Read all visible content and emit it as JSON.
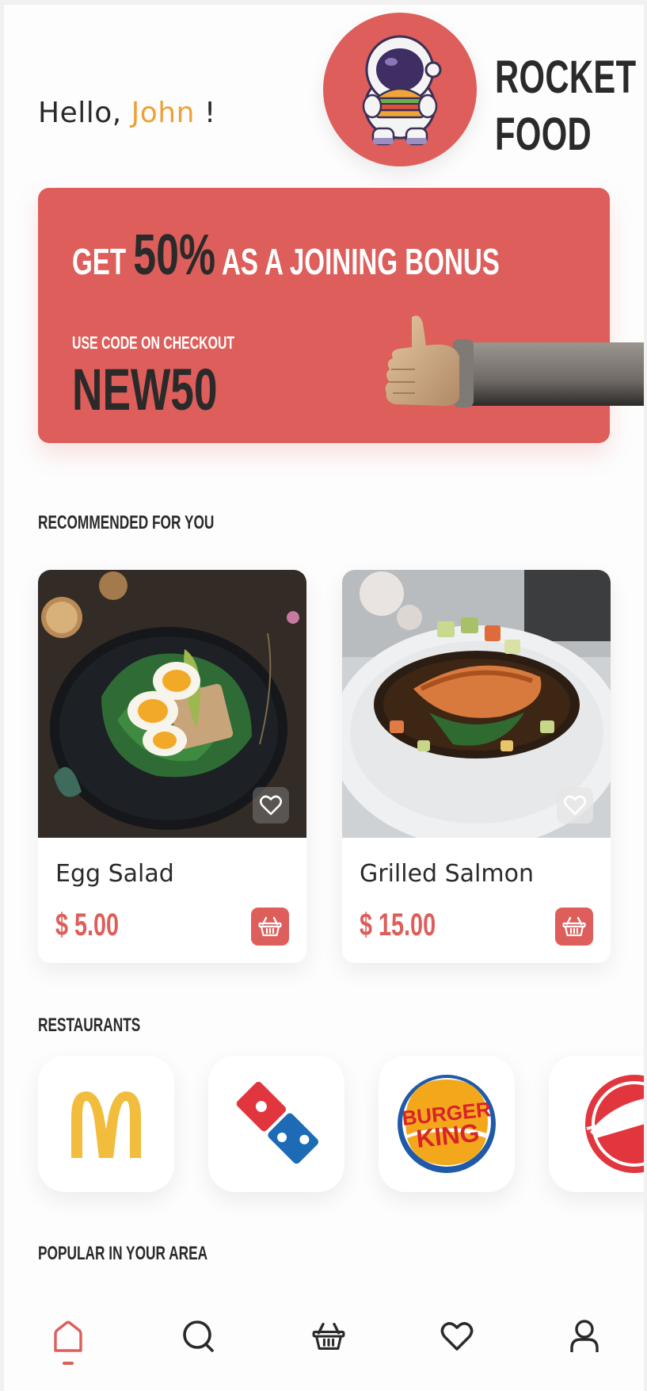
{
  "header": {
    "greeting_prefix": "Hello, ",
    "user_name": "John",
    "greeting_suffix": " !",
    "brand_line1": "ROCKET",
    "brand_line2": "FOOD"
  },
  "promo": {
    "headline_start": "GET ",
    "headline_percent": "50%",
    "headline_end": " AS A JOINING BONUS",
    "subtext": "USE CODE ON CHECKOUT",
    "code": "NEW50"
  },
  "sections": {
    "recommended": "RECOMMENDED FOR YOU",
    "restaurants": "RESTAURANTS",
    "popular": "POPULAR IN YOUR AREA"
  },
  "recommended": [
    {
      "name": "Egg Salad",
      "price": "$ 5.00"
    },
    {
      "name": "Grilled Salmon",
      "price": "$ 15.00"
    }
  ],
  "restaurants": [
    {
      "icon": "mcdonalds-logo"
    },
    {
      "icon": "dominos-logo"
    },
    {
      "icon": "burger-king-logo",
      "logo_text_line1": "BURGER",
      "logo_text_line2": "KING"
    },
    {
      "icon": "pizza-hut-logo"
    }
  ],
  "nav": {
    "active": "home",
    "items": [
      "home-icon",
      "search-icon",
      "basket-icon",
      "heart-icon",
      "profile-icon"
    ]
  },
  "colors": {
    "accent": "#dd5e5a",
    "name_highlight": "#eea13a",
    "text": "#2a2a2a"
  }
}
